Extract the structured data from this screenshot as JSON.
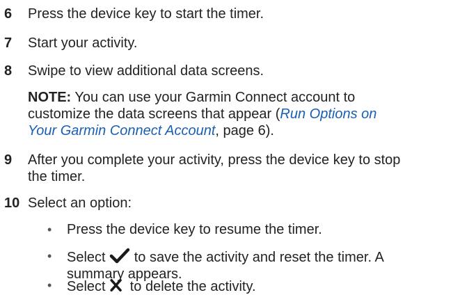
{
  "steps": [
    {
      "num": "6",
      "text": "Press the device key to start the timer."
    },
    {
      "num": "7",
      "text": "Start your activity."
    },
    {
      "num": "8",
      "text": "Swipe to view additional data screens."
    },
    {
      "num": "9",
      "text_line1": "After you complete your activity, press the device key to stop",
      "text_line2": "the timer."
    },
    {
      "num": "10",
      "text": "Select an option:"
    }
  ],
  "note": {
    "label": "NOTE:",
    "line1": "You can use your Garmin Connect account to",
    "line2": "customize the data screens that appear (",
    "link_line1": "Run Options on",
    "link_line2": "Your Garmin Connect Account",
    "tail": ", page 6)."
  },
  "options": {
    "bullet": "•",
    "items": [
      {
        "text": "Press the device key to resume the timer."
      },
      {
        "pre": "Select",
        "icon": "checkmark-icon",
        "post_line1": "to save the activity and reset the timer. A",
        "post_line2": "summary appears."
      },
      {
        "pre": "Select",
        "icon": "x-icon",
        "post_line1": "to delete the activity."
      }
    ]
  },
  "icon_color": "#1a1a1a",
  "link_color": "#1a5fb4"
}
